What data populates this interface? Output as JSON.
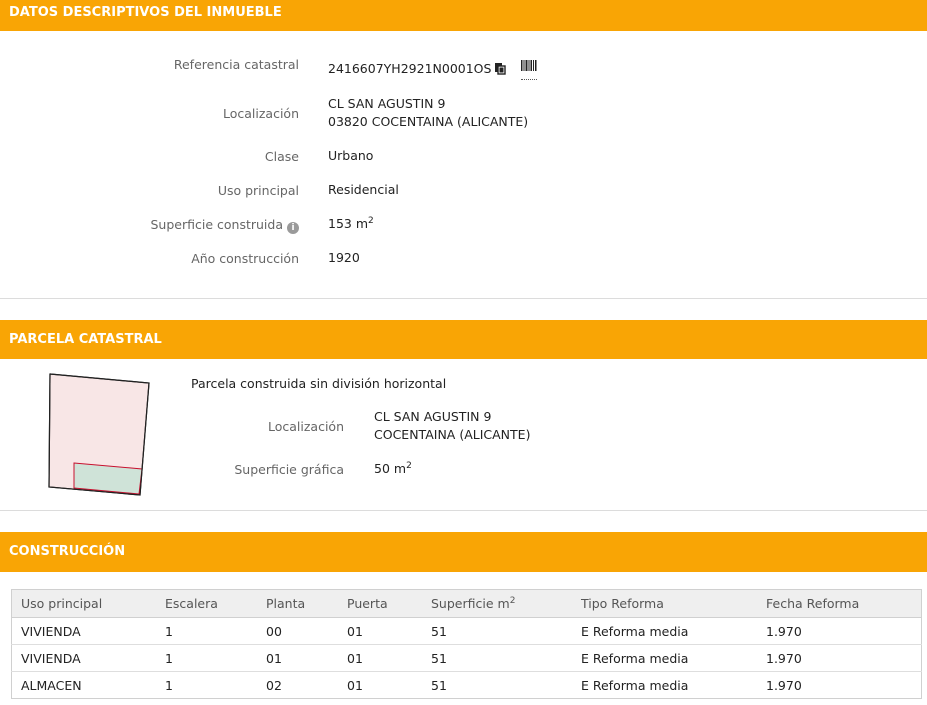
{
  "datos": {
    "title": "DATOS DESCRIPTIVOS DEL INMUEBLE",
    "ref_label": "Referencia catastral",
    "ref_value": "2416607YH2921N0001OS",
    "loc_label": "Localización",
    "loc_line1": "CL SAN AGUSTIN 9",
    "loc_line2": "03820 COCENTAINA (ALICANTE)",
    "clase_label": "Clase",
    "clase_value": "Urbano",
    "uso_label": "Uso principal",
    "uso_value": "Residencial",
    "sup_label": "Superficie construida",
    "sup_value": "153 m",
    "sup_unit_exp": "2",
    "anio_label": "Año construcción",
    "anio_value": "1920"
  },
  "parcela": {
    "title": "PARCELA CATASTRAL",
    "subtitle": "Parcela construida sin división horizontal",
    "loc_label": "Localización",
    "loc_line1": "CL SAN AGUSTIN 9",
    "loc_line2": "COCENTAINA (ALICANTE)",
    "sup_label": "Superficie gráfica",
    "sup_value": "50 m",
    "sup_unit_exp": "2",
    "colors": {
      "parcel_fill": "#f8e6e6",
      "building_fill": "#cfe3d8",
      "boundary": "#c8102e"
    }
  },
  "construccion": {
    "title": "CONSTRUCCIÓN",
    "headers": [
      "Uso principal",
      "Escalera",
      "Planta",
      "Puerta",
      "Superficie m",
      "Tipo Reforma",
      "Fecha Reforma"
    ],
    "superficie_exp": "2",
    "rows": [
      [
        "VIVIENDA",
        "1",
        "00",
        "01",
        "51",
        "E Reforma media",
        "1.970"
      ],
      [
        "VIVIENDA",
        "1",
        "01",
        "01",
        "51",
        "E Reforma media",
        "1.970"
      ],
      [
        "ALMACEN",
        "1",
        "02",
        "01",
        "51",
        "E Reforma media",
        "1.970"
      ]
    ]
  },
  "colors": {
    "accent": "#f9a505"
  }
}
